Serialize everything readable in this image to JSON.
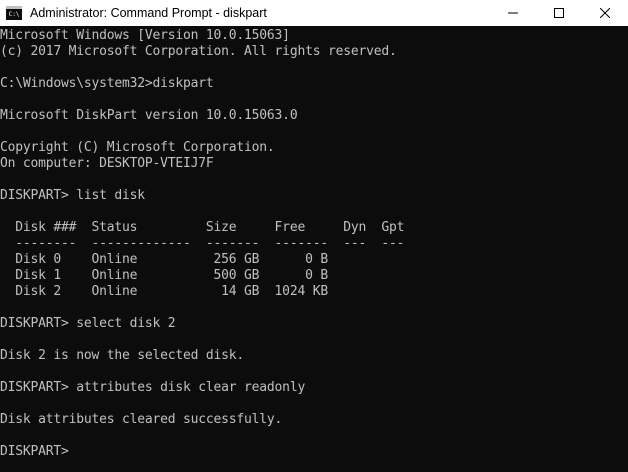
{
  "window": {
    "title": "Administrator: Command Prompt - diskpart",
    "icon_text": "C:\\"
  },
  "console": {
    "lines": [
      "Microsoft Windows [Version 10.0.15063]",
      "(c) 2017 Microsoft Corporation. All rights reserved.",
      "",
      "C:\\Windows\\system32>diskpart",
      "",
      "Microsoft DiskPart version 10.0.15063.0",
      "",
      "Copyright (C) Microsoft Corporation.",
      "On computer: DESKTOP-VTEIJ7F",
      "",
      "DISKPART> list disk",
      "",
      "  Disk ###  Status         Size     Free     Dyn  Gpt",
      "  --------  -------------  -------  -------  ---  ---",
      "  Disk 0    Online          256 GB      0 B",
      "  Disk 1    Online          500 GB      0 B",
      "  Disk 2    Online           14 GB  1024 KB",
      "",
      "DISKPART> select disk 2",
      "",
      "Disk 2 is now the selected disk.",
      "",
      "DISKPART> attributes disk clear readonly",
      "",
      "Disk attributes cleared successfully.",
      "",
      "DISKPART>"
    ]
  },
  "colors": {
    "console_bg": "#0c0c0c",
    "console_text": "#c0c0c0",
    "titlebar_bg": "#ffffff"
  }
}
